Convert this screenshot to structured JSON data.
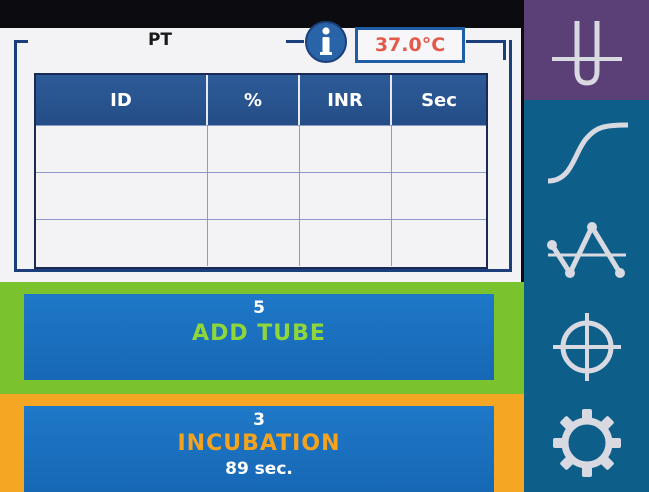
{
  "panel": {
    "title": "PT",
    "temperature": "37.0°C"
  },
  "table": {
    "headers": [
      "ID",
      "%",
      "INR",
      "Sec"
    ],
    "rows": [
      [
        "",
        "",
        "",
        ""
      ],
      [
        "",
        "",
        "",
        ""
      ],
      [
        "",
        "",
        "",
        ""
      ]
    ]
  },
  "actions": {
    "add_tube": {
      "count": "5",
      "label": "ADD TUBE"
    },
    "incubation": {
      "count": "3",
      "label": "INCUBATION",
      "time": "89 sec."
    }
  },
  "sidebar": {
    "items": [
      {
        "icon": "test-tube-icon"
      },
      {
        "icon": "curve-icon"
      },
      {
        "icon": "graph-icon"
      },
      {
        "icon": "crosshair-icon"
      },
      {
        "icon": "gear-icon"
      }
    ]
  },
  "colors": {
    "header_blue": "#244d86",
    "button_blue": "#1a6fbf",
    "add_tube_green": "#7bc22f",
    "incubation_orange": "#f5a623",
    "temperature_red": "#e35a4b",
    "sidebar_blue": "#0d5f8a",
    "sidebar_active": "#5b3f77"
  }
}
